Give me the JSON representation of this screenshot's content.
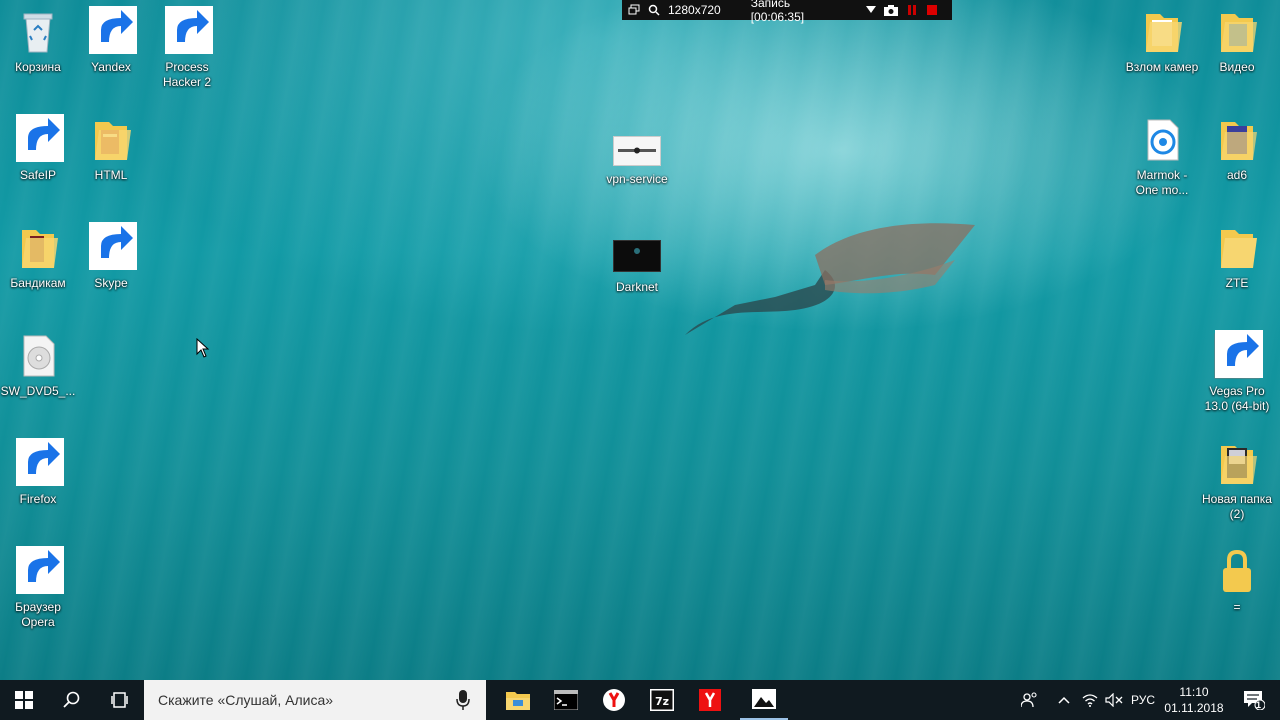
{
  "recorder": {
    "resolution": "1280x720",
    "status": "Запись [00:06:35]"
  },
  "desktop": {
    "icons": {
      "trash": "Корзина",
      "yandex": "Yandex",
      "process_hacker": "Process Hacker 2",
      "safeip": "SafeIP",
      "html": "HTML",
      "bandicam": "Бандикам",
      "skype": "Skype",
      "dvd": "SW_DVD5_...",
      "firefox": "Firefox",
      "opera": "Браузер Opera",
      "vpn": "vpn-service",
      "darknet": "Darknet",
      "vzlom": "Взлом камер",
      "video": "Видео",
      "marmok": "Marmok - One mo...",
      "ad6": "ad6",
      "zte": "ZTE",
      "vegas": "Vegas Pro 13.0 (64-bit)",
      "new_folder": "Новая папка (2)",
      "lock": "="
    }
  },
  "taskbar": {
    "search_placeholder": "Скажите «Слушай, Алиса»",
    "lang": "РУС",
    "time": "11:10",
    "date": "01.11.2018",
    "notifications": "1"
  },
  "colors": {
    "taskbar": "#101a20",
    "water": "#129aa5",
    "folder": "#f3c94e"
  }
}
